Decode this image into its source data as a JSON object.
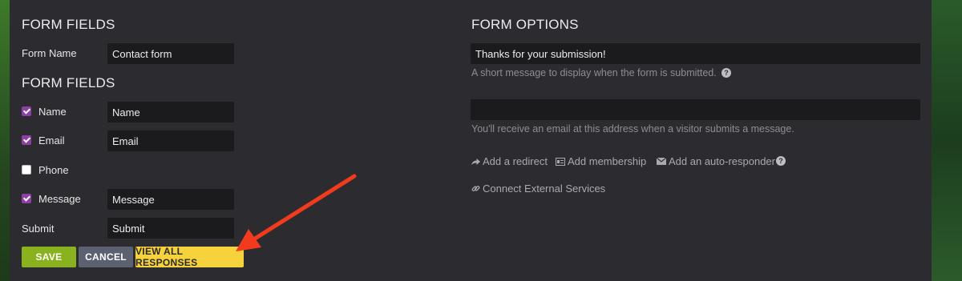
{
  "form_fields": {
    "heading": "FORM FIELDS",
    "form_name_label": "Form Name",
    "form_name_value": "Contact form",
    "fields_heading": "FORM FIELDS",
    "fields": [
      {
        "label": "Name",
        "checked": true,
        "value": "Name"
      },
      {
        "label": "Email",
        "checked": true,
        "value": "Email"
      },
      {
        "label": "Phone",
        "checked": false,
        "value": ""
      },
      {
        "label": "Message",
        "checked": true,
        "value": "Message"
      }
    ],
    "submit_label": "Submit",
    "submit_value": "Submit"
  },
  "buttons": {
    "save": "SAVE",
    "cancel": "CANCEL",
    "view_all": "VIEW ALL RESPONSES"
  },
  "form_options": {
    "heading": "FORM OPTIONS",
    "success_message_value": "Thanks for your submission!",
    "success_message_help": "A short message to display when the form is submitted.",
    "email_value": "",
    "email_help": "You'll receive an email at this address when a visitor submits a message.",
    "links": {
      "redirect": "Add a redirect",
      "membership": "Add membership",
      "autoresponder": "Add an auto-responder",
      "external": "Connect External Services"
    }
  },
  "colors": {
    "panel_bg": "#2c2c30",
    "input_bg": "#1b1b1e",
    "checkbox_checked": "#8e3fa6",
    "save_button": "#8ab21e",
    "cancel_button": "#5c6172",
    "view_button": "#f6d33c",
    "annotation_arrow": "#f23a1c"
  },
  "icons": {
    "help": "question-circle-icon",
    "redirect": "share-arrow-icon",
    "membership": "id-card-icon",
    "autoresponder": "envelope-icon",
    "external": "link-icon",
    "annotation": "red-arrow-icon"
  }
}
